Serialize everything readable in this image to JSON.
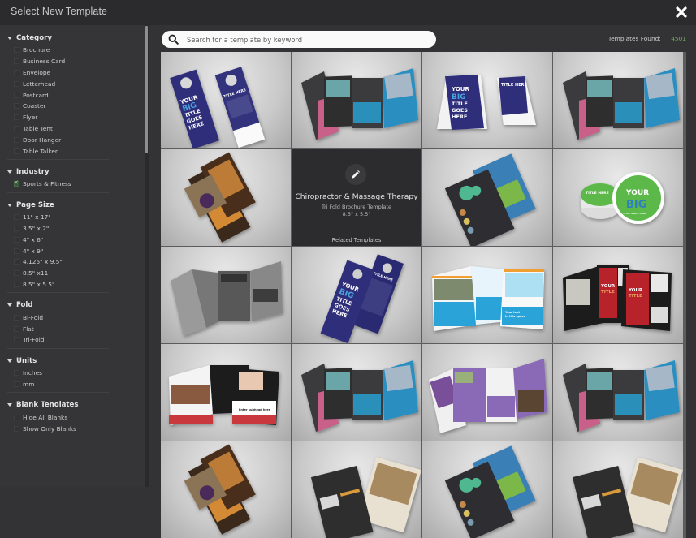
{
  "window": {
    "title": "Select New Template",
    "close_icon": "close-icon"
  },
  "sidebar": {
    "sections": [
      {
        "title": "Category",
        "items": [
          {
            "label": "Brochure",
            "checked": false
          },
          {
            "label": "Business Card",
            "checked": false
          },
          {
            "label": "Envelope",
            "checked": false
          },
          {
            "label": "Letterhead",
            "checked": false
          },
          {
            "label": "Postcard",
            "checked": false
          },
          {
            "label": "Coaster",
            "checked": false
          },
          {
            "label": "Flyer",
            "checked": false
          },
          {
            "label": "Table Tent",
            "checked": false
          },
          {
            "label": "Door Hanger",
            "checked": false
          },
          {
            "label": "Table Talker",
            "checked": false
          }
        ]
      },
      {
        "title": "Industry",
        "items": [
          {
            "label": "Sports & Fitness",
            "checked": true
          }
        ]
      },
      {
        "title": "Page Size",
        "items": [
          {
            "label": "11\" x 17\"",
            "checked": false
          },
          {
            "label": "3.5\" x 2\"",
            "checked": false
          },
          {
            "label": "4\" x 6\"",
            "checked": false
          },
          {
            "label": "4\" x 9\"",
            "checked": false
          },
          {
            "label": "4.125\" x 9.5\"",
            "checked": false
          },
          {
            "label": "8.5\" x11",
            "checked": false
          },
          {
            "label": "8.5\" x 5.5\"",
            "checked": false
          }
        ]
      },
      {
        "title": "Fold",
        "items": [
          {
            "label": "Bi-Fold",
            "checked": false
          },
          {
            "label": "Flat",
            "checked": false
          },
          {
            "label": "Tri-Fold",
            "checked": false
          }
        ]
      },
      {
        "title": "Units",
        "items": [
          {
            "label": "Inches",
            "checked": false
          },
          {
            "label": "mm",
            "checked": false
          }
        ]
      },
      {
        "title": "Blank Tenolates",
        "items": [
          {
            "label": "Hide All Blanks",
            "checked": false
          },
          {
            "label": "Show Only Blanks",
            "checked": false
          }
        ]
      }
    ]
  },
  "search": {
    "placeholder": "Search for a template by keyword",
    "value": ""
  },
  "results": {
    "label": "Templates Found:",
    "count": "4501",
    "count_color": "#6fae5f"
  },
  "templates": [
    {
      "kind": "door-hanger",
      "art_text": [
        "YOUR",
        "BIG",
        "TITLE",
        "GOES",
        "HERE"
      ],
      "side_text": "TITLE HERE"
    },
    {
      "kind": "trifold-travel"
    },
    {
      "kind": "table-tent",
      "art_text": [
        "YOUR",
        "BIG",
        "TITLE",
        "GOES",
        "HERE"
      ],
      "side_text": "TITLE HERE"
    },
    {
      "kind": "trifold-travel"
    },
    {
      "kind": "trifold-massage"
    },
    {
      "kind": "hover",
      "title": "Chiropractor & Massage Therapy",
      "subtitle": "Tri Fold Brochure Template",
      "size": "8.5\" x 5.5\"",
      "related": "Related Templates"
    },
    {
      "kind": "flyer-green"
    },
    {
      "kind": "coaster",
      "art_text": [
        "YOUR",
        "BIG",
        "TITLE GOES HERE"
      ],
      "side_text": "TITLE HERE"
    },
    {
      "kind": "trifold-gray"
    },
    {
      "kind": "door-hanger-single",
      "art_text": [
        "YOUR",
        "BIG",
        "TITLE",
        "GOES",
        "HERE"
      ],
      "side_text": "TITLE HERE"
    },
    {
      "kind": "bifold-watersport",
      "art_text": [
        "Your text",
        "in this space"
      ]
    },
    {
      "kind": "trifold-medical",
      "art_text": [
        "YOUR",
        "TITLE"
      ]
    },
    {
      "kind": "bifold-red",
      "art_text": [
        "Enter subhead here"
      ]
    },
    {
      "kind": "trifold-travel"
    },
    {
      "kind": "trifold-purple"
    },
    {
      "kind": "trifold-travel"
    },
    {
      "kind": "trifold-massage"
    },
    {
      "kind": "flyer-restaurant"
    },
    {
      "kind": "flyer-green"
    },
    {
      "kind": "flyer-restaurant"
    }
  ]
}
